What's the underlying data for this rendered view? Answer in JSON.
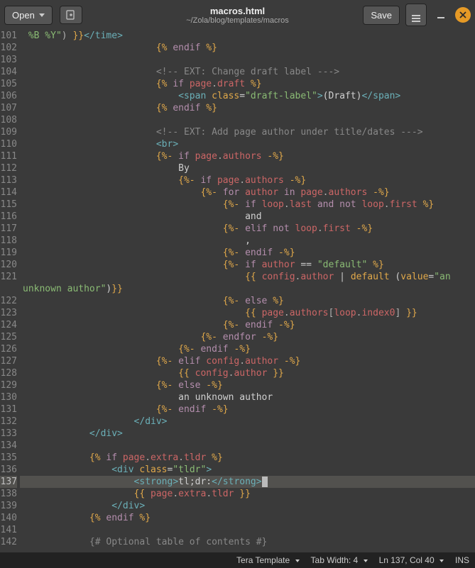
{
  "window": {
    "title_main": "macros.html",
    "title_sub": "~/Zola/blog/templates/macros"
  },
  "toolbar": {
    "open_label": "Open",
    "save_label": "Save"
  },
  "status": {
    "language": "Tera Template",
    "tab_width": "Tab Width: 4",
    "position": "Ln 137, Col 40",
    "mode": "INS"
  },
  "editor": {
    "first_line_no": 101,
    "current_line_no": 137,
    "line_numbers": [
      "101",
      "102",
      "103",
      "104",
      "105",
      "106",
      "107",
      "108",
      "109",
      "110",
      "111",
      "112",
      "113",
      "114",
      "115",
      "116",
      "117",
      "118",
      "119",
      "120",
      "121",
      "",
      "122",
      "123",
      "124",
      "125",
      "126",
      "127",
      "128",
      "129",
      "130",
      "131",
      "132",
      "133",
      "134",
      "135",
      "136",
      "137",
      "138",
      "139",
      "140",
      "141",
      "142"
    ],
    "lines": {
      "101": {
        "indent": 0,
        "tokens": [
          [
            "tk-str",
            " %B %Y\""
          ],
          [
            "tk-punc",
            ") "
          ],
          [
            "tk-delim",
            "}}"
          ],
          [
            "tk-tag",
            "</time>"
          ]
        ]
      },
      "102": {
        "indent": 24,
        "tokens": [
          [
            "tk-delim",
            "{%"
          ],
          [
            "tk-plain",
            " "
          ],
          [
            "tk-kw",
            "endif"
          ],
          [
            "tk-plain",
            " "
          ],
          [
            "tk-delim",
            "%}"
          ]
        ]
      },
      "103": {
        "indent": 0,
        "tokens": []
      },
      "104": {
        "indent": 24,
        "tokens": [
          [
            "tk-comment",
            "<!-- EXT: Change draft label --->"
          ]
        ]
      },
      "105": {
        "indent": 24,
        "tokens": [
          [
            "tk-delim",
            "{%"
          ],
          [
            "tk-plain",
            " "
          ],
          [
            "tk-kw",
            "if"
          ],
          [
            "tk-plain",
            " "
          ],
          [
            "tk-name",
            "page"
          ],
          [
            "tk-punc",
            "."
          ],
          [
            "tk-name",
            "draft"
          ],
          [
            "tk-plain",
            " "
          ],
          [
            "tk-delim",
            "%}"
          ]
        ]
      },
      "106": {
        "indent": 28,
        "tokens": [
          [
            "tk-tag",
            "<span "
          ],
          [
            "tk-attr",
            "class"
          ],
          [
            "tk-op",
            "="
          ],
          [
            "tk-str",
            "\"draft-label\""
          ],
          [
            "tk-tag",
            ">"
          ],
          [
            "tk-plain",
            "(Draft)"
          ],
          [
            "tk-tag",
            "</span>"
          ]
        ]
      },
      "107": {
        "indent": 24,
        "tokens": [
          [
            "tk-delim",
            "{%"
          ],
          [
            "tk-plain",
            " "
          ],
          [
            "tk-kw",
            "endif"
          ],
          [
            "tk-plain",
            " "
          ],
          [
            "tk-delim",
            "%}"
          ]
        ]
      },
      "108": {
        "indent": 0,
        "tokens": []
      },
      "109": {
        "indent": 24,
        "tokens": [
          [
            "tk-comment",
            "<!-- EXT: Add page author under title/dates --->"
          ]
        ]
      },
      "110": {
        "indent": 24,
        "tokens": [
          [
            "tk-tag",
            "<br>"
          ]
        ]
      },
      "111": {
        "indent": 24,
        "tokens": [
          [
            "tk-delim",
            "{%-"
          ],
          [
            "tk-plain",
            " "
          ],
          [
            "tk-kw",
            "if"
          ],
          [
            "tk-plain",
            " "
          ],
          [
            "tk-name",
            "page"
          ],
          [
            "tk-punc",
            "."
          ],
          [
            "tk-name",
            "authors"
          ],
          [
            "tk-plain",
            " "
          ],
          [
            "tk-delim",
            "-%}"
          ]
        ]
      },
      "112": {
        "indent": 28,
        "tokens": [
          [
            "tk-plain",
            "By"
          ]
        ]
      },
      "113": {
        "indent": 28,
        "tokens": [
          [
            "tk-delim",
            "{%-"
          ],
          [
            "tk-plain",
            " "
          ],
          [
            "tk-kw",
            "if"
          ],
          [
            "tk-plain",
            " "
          ],
          [
            "tk-name",
            "page"
          ],
          [
            "tk-punc",
            "."
          ],
          [
            "tk-name",
            "authors"
          ],
          [
            "tk-plain",
            " "
          ],
          [
            "tk-delim",
            "-%}"
          ]
        ]
      },
      "114": {
        "indent": 32,
        "tokens": [
          [
            "tk-delim",
            "{%-"
          ],
          [
            "tk-plain",
            " "
          ],
          [
            "tk-kw",
            "for"
          ],
          [
            "tk-plain",
            " "
          ],
          [
            "tk-name",
            "author"
          ],
          [
            "tk-plain",
            " "
          ],
          [
            "tk-kw",
            "in"
          ],
          [
            "tk-plain",
            " "
          ],
          [
            "tk-name",
            "page"
          ],
          [
            "tk-punc",
            "."
          ],
          [
            "tk-name",
            "authors"
          ],
          [
            "tk-plain",
            " "
          ],
          [
            "tk-delim",
            "-%}"
          ]
        ]
      },
      "115": {
        "indent": 36,
        "tokens": [
          [
            "tk-delim",
            "{%-"
          ],
          [
            "tk-plain",
            " "
          ],
          [
            "tk-kw",
            "if"
          ],
          [
            "tk-plain",
            " "
          ],
          [
            "tk-name",
            "loop"
          ],
          [
            "tk-punc",
            "."
          ],
          [
            "tk-name",
            "last"
          ],
          [
            "tk-plain",
            " "
          ],
          [
            "tk-kw",
            "and"
          ],
          [
            "tk-plain",
            " "
          ],
          [
            "tk-kw",
            "not"
          ],
          [
            "tk-plain",
            " "
          ],
          [
            "tk-name",
            "loop"
          ],
          [
            "tk-punc",
            "."
          ],
          [
            "tk-name",
            "first"
          ],
          [
            "tk-plain",
            " "
          ],
          [
            "tk-delim",
            "%}"
          ]
        ]
      },
      "116": {
        "indent": 40,
        "tokens": [
          [
            "tk-plain",
            "and"
          ]
        ]
      },
      "117": {
        "indent": 36,
        "tokens": [
          [
            "tk-delim",
            "{%-"
          ],
          [
            "tk-plain",
            " "
          ],
          [
            "tk-kw",
            "elif"
          ],
          [
            "tk-plain",
            " "
          ],
          [
            "tk-kw",
            "not"
          ],
          [
            "tk-plain",
            " "
          ],
          [
            "tk-name",
            "loop"
          ],
          [
            "tk-punc",
            "."
          ],
          [
            "tk-name",
            "first"
          ],
          [
            "tk-plain",
            " "
          ],
          [
            "tk-delim",
            "-%}"
          ]
        ]
      },
      "118": {
        "indent": 40,
        "tokens": [
          [
            "tk-plain",
            ","
          ]
        ]
      },
      "119": {
        "indent": 36,
        "tokens": [
          [
            "tk-delim",
            "{%-"
          ],
          [
            "tk-plain",
            " "
          ],
          [
            "tk-kw",
            "endif"
          ],
          [
            "tk-plain",
            " "
          ],
          [
            "tk-delim",
            "-%}"
          ]
        ]
      },
      "120": {
        "indent": 36,
        "tokens": [
          [
            "tk-delim",
            "{%-"
          ],
          [
            "tk-plain",
            " "
          ],
          [
            "tk-kw",
            "if"
          ],
          [
            "tk-plain",
            " "
          ],
          [
            "tk-name",
            "author"
          ],
          [
            "tk-plain",
            " "
          ],
          [
            "tk-op",
            "=="
          ],
          [
            "tk-plain",
            " "
          ],
          [
            "tk-str",
            "\"default\""
          ],
          [
            "tk-plain",
            " "
          ],
          [
            "tk-delim",
            "%}"
          ]
        ]
      },
      "121": {
        "indent": 40,
        "tokens": [
          [
            "tk-delim",
            "{{"
          ],
          [
            "tk-plain",
            " "
          ],
          [
            "tk-name",
            "config"
          ],
          [
            "tk-punc",
            "."
          ],
          [
            "tk-name",
            "author"
          ],
          [
            "tk-plain",
            " "
          ],
          [
            "tk-op",
            "|"
          ],
          [
            "tk-plain",
            " "
          ],
          [
            "tk-func",
            "default"
          ],
          [
            "tk-plain",
            " ("
          ],
          [
            "tk-attr",
            "value"
          ],
          [
            "tk-op",
            "="
          ],
          [
            "tk-str",
            "\"an "
          ]
        ]
      },
      "121b": {
        "indent": 0,
        "tokens": [
          [
            "tk-str",
            "unknown author\""
          ],
          [
            "tk-plain",
            ")"
          ],
          [
            "tk-delim",
            "}}"
          ]
        ]
      },
      "122": {
        "indent": 36,
        "tokens": [
          [
            "tk-delim",
            "{%-"
          ],
          [
            "tk-plain",
            " "
          ],
          [
            "tk-kw",
            "else"
          ],
          [
            "tk-plain",
            " "
          ],
          [
            "tk-delim",
            "%}"
          ]
        ]
      },
      "123": {
        "indent": 40,
        "tokens": [
          [
            "tk-delim",
            "{{"
          ],
          [
            "tk-plain",
            " "
          ],
          [
            "tk-name",
            "page"
          ],
          [
            "tk-punc",
            "."
          ],
          [
            "tk-name",
            "authors"
          ],
          [
            "tk-punc",
            "["
          ],
          [
            "tk-name",
            "loop"
          ],
          [
            "tk-punc",
            "."
          ],
          [
            "tk-name",
            "index0"
          ],
          [
            "tk-punc",
            "]"
          ],
          [
            "tk-plain",
            " "
          ],
          [
            "tk-delim",
            "}}"
          ]
        ]
      },
      "124": {
        "indent": 36,
        "tokens": [
          [
            "tk-delim",
            "{%-"
          ],
          [
            "tk-plain",
            " "
          ],
          [
            "tk-kw",
            "endif"
          ],
          [
            "tk-plain",
            " "
          ],
          [
            "tk-delim",
            "-%}"
          ]
        ]
      },
      "125": {
        "indent": 32,
        "tokens": [
          [
            "tk-delim",
            "{%-"
          ],
          [
            "tk-plain",
            " "
          ],
          [
            "tk-kw",
            "endfor"
          ],
          [
            "tk-plain",
            " "
          ],
          [
            "tk-delim",
            "-%}"
          ]
        ]
      },
      "126": {
        "indent": 28,
        "tokens": [
          [
            "tk-delim",
            "{%-"
          ],
          [
            "tk-plain",
            " "
          ],
          [
            "tk-kw",
            "endif"
          ],
          [
            "tk-plain",
            " "
          ],
          [
            "tk-delim",
            "-%}"
          ]
        ]
      },
      "127": {
        "indent": 24,
        "tokens": [
          [
            "tk-delim",
            "{%-"
          ],
          [
            "tk-plain",
            " "
          ],
          [
            "tk-kw",
            "elif"
          ],
          [
            "tk-plain",
            " "
          ],
          [
            "tk-name",
            "config"
          ],
          [
            "tk-punc",
            "."
          ],
          [
            "tk-name",
            "author"
          ],
          [
            "tk-plain",
            " "
          ],
          [
            "tk-delim",
            "-%}"
          ]
        ]
      },
      "128": {
        "indent": 28,
        "tokens": [
          [
            "tk-delim",
            "{{"
          ],
          [
            "tk-plain",
            " "
          ],
          [
            "tk-name",
            "config"
          ],
          [
            "tk-punc",
            "."
          ],
          [
            "tk-name",
            "author"
          ],
          [
            "tk-plain",
            " "
          ],
          [
            "tk-delim",
            "}}"
          ]
        ]
      },
      "129": {
        "indent": 24,
        "tokens": [
          [
            "tk-delim",
            "{%-"
          ],
          [
            "tk-plain",
            " "
          ],
          [
            "tk-kw",
            "else"
          ],
          [
            "tk-plain",
            " "
          ],
          [
            "tk-delim",
            "-%}"
          ]
        ]
      },
      "130": {
        "indent": 28,
        "tokens": [
          [
            "tk-plain",
            "an unknown author"
          ]
        ]
      },
      "131": {
        "indent": 24,
        "tokens": [
          [
            "tk-delim",
            "{%-"
          ],
          [
            "tk-plain",
            " "
          ],
          [
            "tk-kw",
            "endif"
          ],
          [
            "tk-plain",
            " "
          ],
          [
            "tk-delim",
            "-%}"
          ]
        ]
      },
      "132": {
        "indent": 20,
        "tokens": [
          [
            "tk-tag",
            "</div>"
          ]
        ]
      },
      "133": {
        "indent": 12,
        "tokens": [
          [
            "tk-tag",
            "</div>"
          ]
        ]
      },
      "134": {
        "indent": 0,
        "tokens": []
      },
      "135": {
        "indent": 12,
        "tokens": [
          [
            "tk-delim",
            "{%"
          ],
          [
            "tk-plain",
            " "
          ],
          [
            "tk-kw",
            "if"
          ],
          [
            "tk-plain",
            " "
          ],
          [
            "tk-name",
            "page"
          ],
          [
            "tk-punc",
            "."
          ],
          [
            "tk-name",
            "extra"
          ],
          [
            "tk-punc",
            "."
          ],
          [
            "tk-name",
            "tldr"
          ],
          [
            "tk-plain",
            " "
          ],
          [
            "tk-delim",
            "%}"
          ]
        ]
      },
      "136": {
        "indent": 16,
        "tokens": [
          [
            "tk-tag",
            "<div "
          ],
          [
            "tk-attr",
            "class"
          ],
          [
            "tk-op",
            "="
          ],
          [
            "tk-str",
            "\"tldr\""
          ],
          [
            "tk-tag",
            ">"
          ]
        ]
      },
      "137": {
        "indent": 20,
        "tokens": [
          [
            "tk-tag",
            "<strong>"
          ],
          [
            "tk-plain",
            "tl;dr:"
          ],
          [
            "tk-tag",
            "</strong>"
          ]
        ],
        "cursor": true
      },
      "138": {
        "indent": 20,
        "tokens": [
          [
            "tk-delim",
            "{{"
          ],
          [
            "tk-plain",
            " "
          ],
          [
            "tk-name",
            "page"
          ],
          [
            "tk-punc",
            "."
          ],
          [
            "tk-name",
            "extra"
          ],
          [
            "tk-punc",
            "."
          ],
          [
            "tk-name",
            "tldr"
          ],
          [
            "tk-plain",
            " "
          ],
          [
            "tk-delim",
            "}}"
          ]
        ]
      },
      "139": {
        "indent": 16,
        "tokens": [
          [
            "tk-tag",
            "</div>"
          ]
        ]
      },
      "140": {
        "indent": 12,
        "tokens": [
          [
            "tk-delim",
            "{%"
          ],
          [
            "tk-plain",
            " "
          ],
          [
            "tk-kw",
            "endif"
          ],
          [
            "tk-plain",
            " "
          ],
          [
            "tk-delim",
            "%}"
          ]
        ]
      },
      "141": {
        "indent": 0,
        "tokens": []
      },
      "142": {
        "indent": 12,
        "tokens": [
          [
            "tk-comment",
            "{# Optional table of contents #}"
          ]
        ]
      }
    },
    "physical_order": [
      "101",
      "102",
      "103",
      "104",
      "105",
      "106",
      "107",
      "108",
      "109",
      "110",
      "111",
      "112",
      "113",
      "114",
      "115",
      "116",
      "117",
      "118",
      "119",
      "120",
      "121",
      "121b",
      "122",
      "123",
      "124",
      "125",
      "126",
      "127",
      "128",
      "129",
      "130",
      "131",
      "132",
      "133",
      "134",
      "135",
      "136",
      "137",
      "138",
      "139",
      "140",
      "141",
      "142"
    ]
  }
}
